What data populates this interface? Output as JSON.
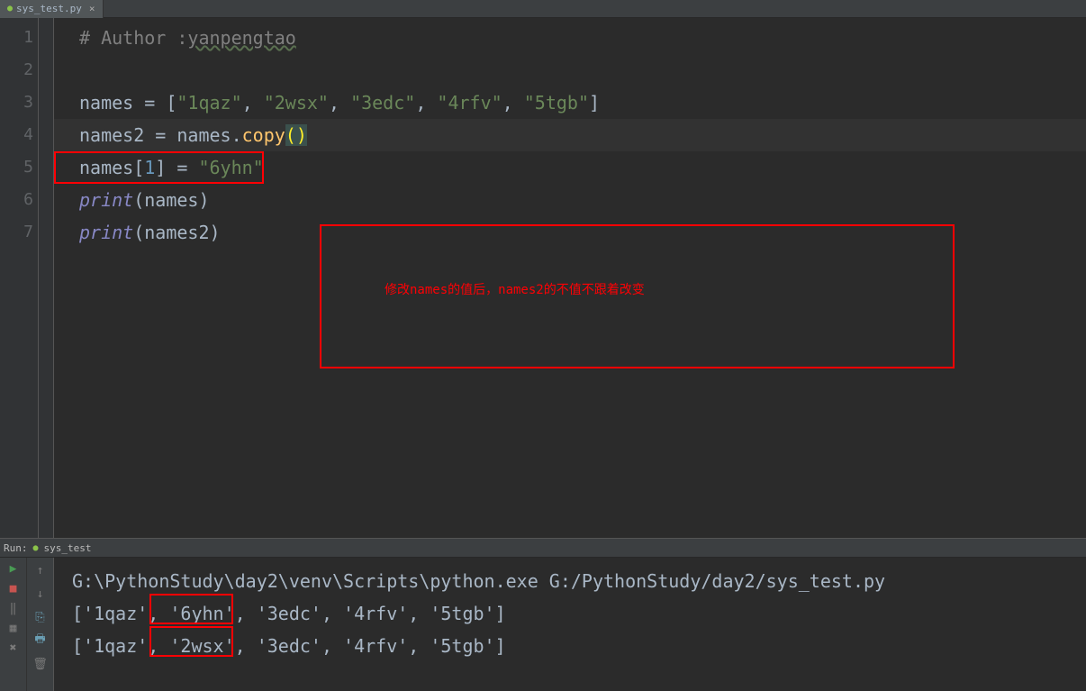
{
  "tab": {
    "filename": "sys_test.py",
    "close": "×"
  },
  "gutter": [
    "1",
    "2",
    "3",
    "4",
    "5",
    "6",
    "7"
  ],
  "code": {
    "l1_comment": "# Author :",
    "l1_author": "yanpengtao",
    "l3a": "names = [",
    "l3s1": "\"1qaz\"",
    "l3c": ", ",
    "l3s2": "\"2wsx\"",
    "l3s3": "\"3edc\"",
    "l3s4": "\"4rfv\"",
    "l3s5": "\"5tgb\"",
    "l3b": "]",
    "l4a": "names2 = names.",
    "l4copy": "copy",
    "l4p": "()",
    "l5a": "names[",
    "l5n": "1",
    "l5b": "] = ",
    "l5s": "\"6yhn\"",
    "l6p": "print",
    "l6a": "(names)",
    "l7p": "print",
    "l7a": "(names2)"
  },
  "annotation": "修改names的值后，names2的不值不跟着改变",
  "run": {
    "label": "Run:",
    "name": "sys_test"
  },
  "output": {
    "cmd": "G:\\PythonStudy\\day2\\venv\\Scripts\\python.exe G:/PythonStudy/day2/sys_test.py",
    "l1": "['1qaz', '6yhn', '3edc', '4rfv', '5tgb']",
    "l2": "['1qaz', '2wsx', '3edc', '4rfv', '5tgb']"
  }
}
